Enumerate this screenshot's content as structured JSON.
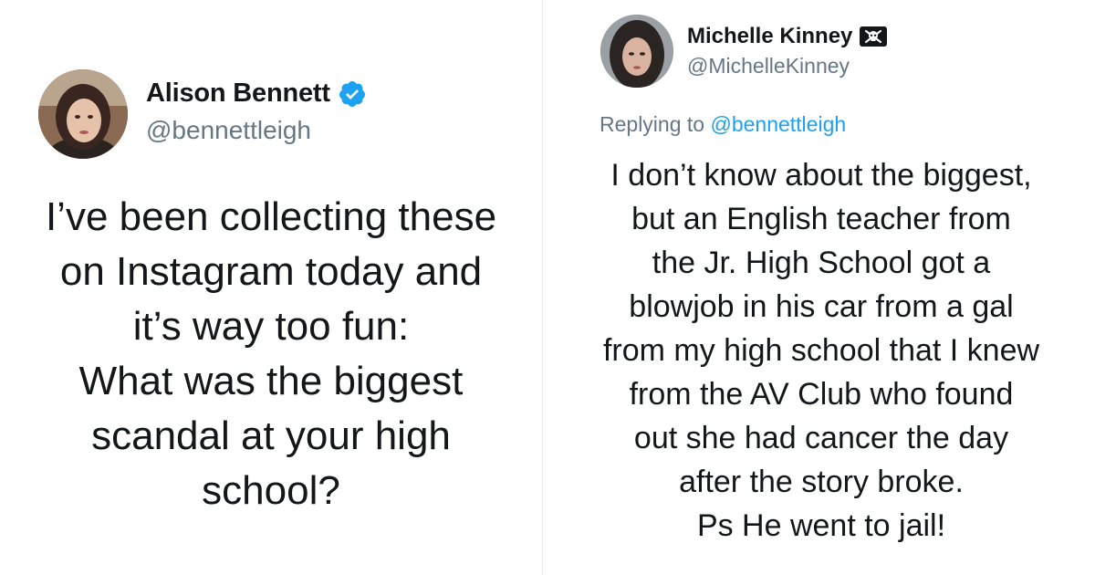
{
  "left_tweet": {
    "display_name": "Alison Bennett",
    "handle": "@bennettleigh",
    "verified": true,
    "lines": [
      "I’ve been collecting these",
      "on Instagram today and",
      "it’s way too fun:",
      "What was the biggest",
      "scandal at your high",
      "school?"
    ]
  },
  "right_tweet": {
    "display_name": "Michelle Kinney",
    "handle": "@MichelleKinney",
    "badge_icon": "skull-crossbones-icon",
    "replying_to_label": "Replying to",
    "replying_to_handle": "@bennettleigh",
    "lines": [
      "I don’t know about the biggest,",
      "but an English teacher from",
      "the Jr. High School got a",
      "blowjob in his car from a gal",
      "from my high school that I knew",
      "from the AV Club who found",
      "out she had cancer the day",
      "after the story broke.",
      "Ps He went to jail!"
    ]
  },
  "colors": {
    "text": "#14171a",
    "secondary": "#657786",
    "accent": "#1da1f2",
    "divider": "#e6ecf0"
  }
}
